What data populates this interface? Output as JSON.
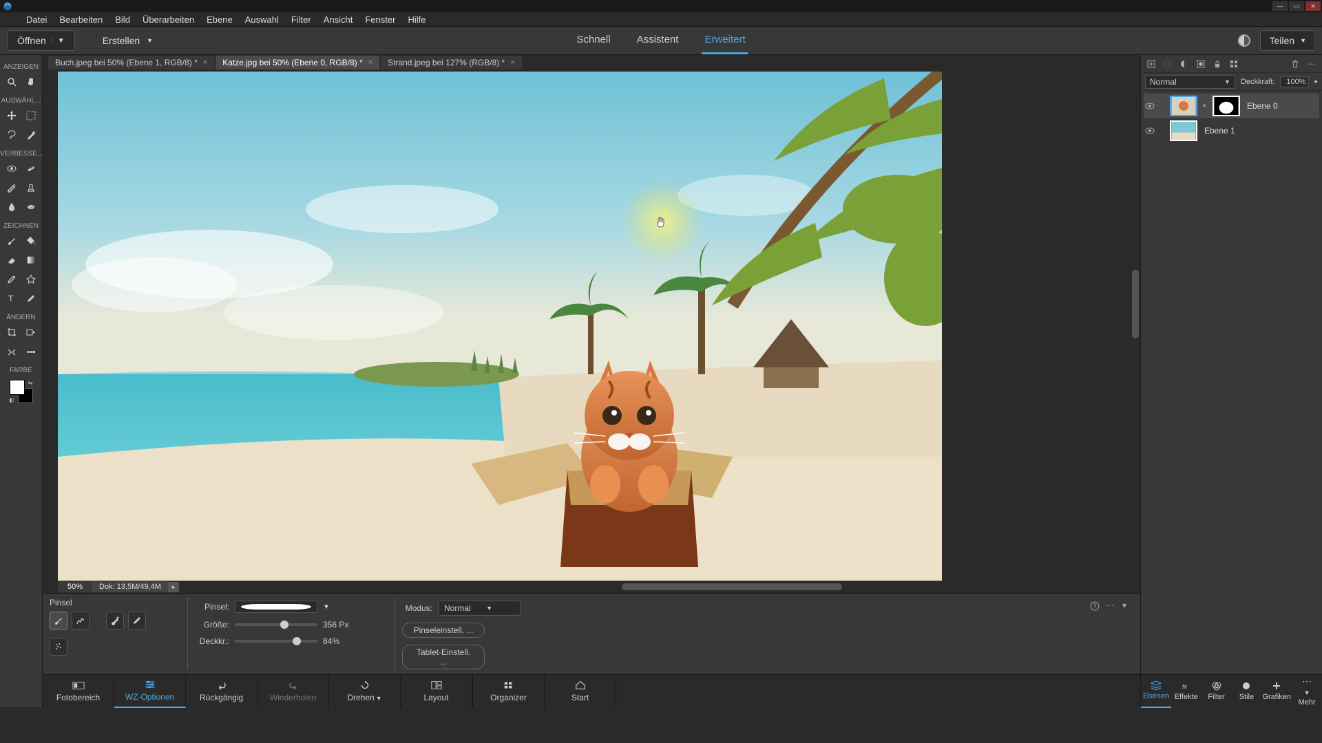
{
  "menubar": [
    "Datei",
    "Bearbeiten",
    "Bild",
    "Überarbeiten",
    "Ebene",
    "Auswahl",
    "Filter",
    "Ansicht",
    "Fenster",
    "Hilfe"
  ],
  "secbar": {
    "open": "Öffnen",
    "create": "Erstellen",
    "modes": {
      "quick": "Schnell",
      "guided": "Assistent",
      "expert": "Erweitert"
    },
    "share": "Teilen"
  },
  "lefttools": {
    "s_view": "ANZEIGEN",
    "s_select": "AUSWÄHL...",
    "s_enhance": "VERBESSE...",
    "s_draw": "ZEICHNEN",
    "s_modify": "ÄNDERN",
    "s_color": "FARBE"
  },
  "doctabs": [
    {
      "label": "Buch.jpeg bei 50% (Ebene 1, RGB/8) *"
    },
    {
      "label": "Katze.jpg bei 50% (Ebene 0, RGB/8) *"
    },
    {
      "label": "Strand.jpeg bei 127% (RGB/8) *"
    }
  ],
  "canvas_status": {
    "zoom": "50%",
    "docinfo": "Dok: 13,5M/49,4M"
  },
  "options": {
    "title": "Pinsel",
    "brush_label": "Pinsel:",
    "size_label": "Größe:",
    "size_value": "356 Px",
    "size_pct": 60,
    "opac_label": "Deckkr.:",
    "opac_value": "84%",
    "opac_pct": 75,
    "mode_label": "Modus:",
    "mode_value": "Normal",
    "brush_settings": "Pinseleinstell. ...",
    "tablet_settings": "Tablet-Einstell. ..."
  },
  "bottomtabs": {
    "photobin": "Fotobereich",
    "tooloptions": "WZ-Optionen",
    "undo": "Rückgängig",
    "redo": "Wiederholen",
    "rotate": "Drehen",
    "layout": "Layout",
    "organizer": "Organizer",
    "home": "Start"
  },
  "layerpanel": {
    "blend": "Normal",
    "opacity_label": "Deckkraft:",
    "opacity_value": "100%",
    "layers": [
      {
        "name": "Ebene 0"
      },
      {
        "name": "Ebene 1"
      }
    ]
  },
  "righttabs": {
    "layers": "Ebenen",
    "effects": "Effekte",
    "filters": "Filter",
    "styles": "Stile",
    "graphics": "Grafiken",
    "more": "Mehr"
  }
}
